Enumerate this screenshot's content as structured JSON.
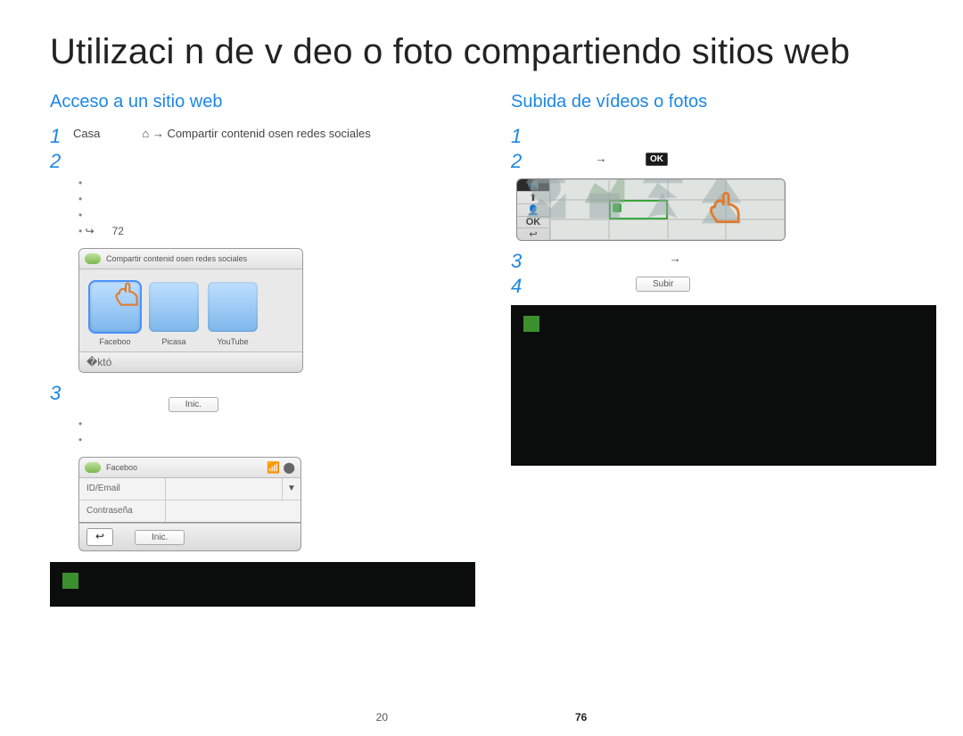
{
  "title": "Utilizaci n de v deo o foto compartiendo sitios web",
  "left": {
    "heading": "Acceso a un sitio web",
    "step1_a": "Casa",
    "step1_b": "Compartir contenid osen redes sociales",
    "step2_bullets": [
      "",
      "",
      "",
      ""
    ],
    "step2_ref": "72",
    "share_header": "Compartir contenid osen redes sociales",
    "tiles": [
      "Faceboo",
      "Picasa",
      "YouTube"
    ],
    "step3_login_btn": "Inic.",
    "step3_bullets": [
      "",
      ""
    ],
    "login": {
      "title": "Faceboo",
      "id_label": "ID/Email",
      "pw_label": "Contraseña",
      "back": "↩",
      "login_btn": "Inic."
    },
    "note_lines": [
      "",
      ""
    ]
  },
  "right": {
    "heading": "Subida de vídeos o fotos",
    "ok_label": "OK",
    "side_icons": [
      "📹",
      "⬆",
      "👤",
      "OK",
      "↩"
    ],
    "upload_btn": "Subir",
    "note_lines": [
      "",
      "",
      "",
      "",
      "",
      "",
      "",
      ""
    ]
  },
  "footer": {
    "left": "20",
    "page": "76"
  }
}
